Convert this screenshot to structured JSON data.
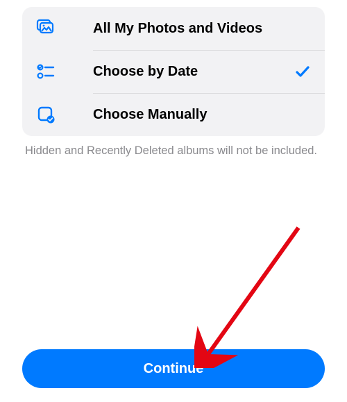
{
  "options": [
    {
      "id": "all",
      "label": "All My Photos and Videos",
      "selected": false
    },
    {
      "id": "by-date",
      "label": "Choose by Date",
      "selected": true
    },
    {
      "id": "manually",
      "label": "Choose Manually",
      "selected": false
    }
  ],
  "footer_note": "Hidden and Recently Deleted albums will not be included.",
  "continue_label": "Continue",
  "accent": "#007aff"
}
